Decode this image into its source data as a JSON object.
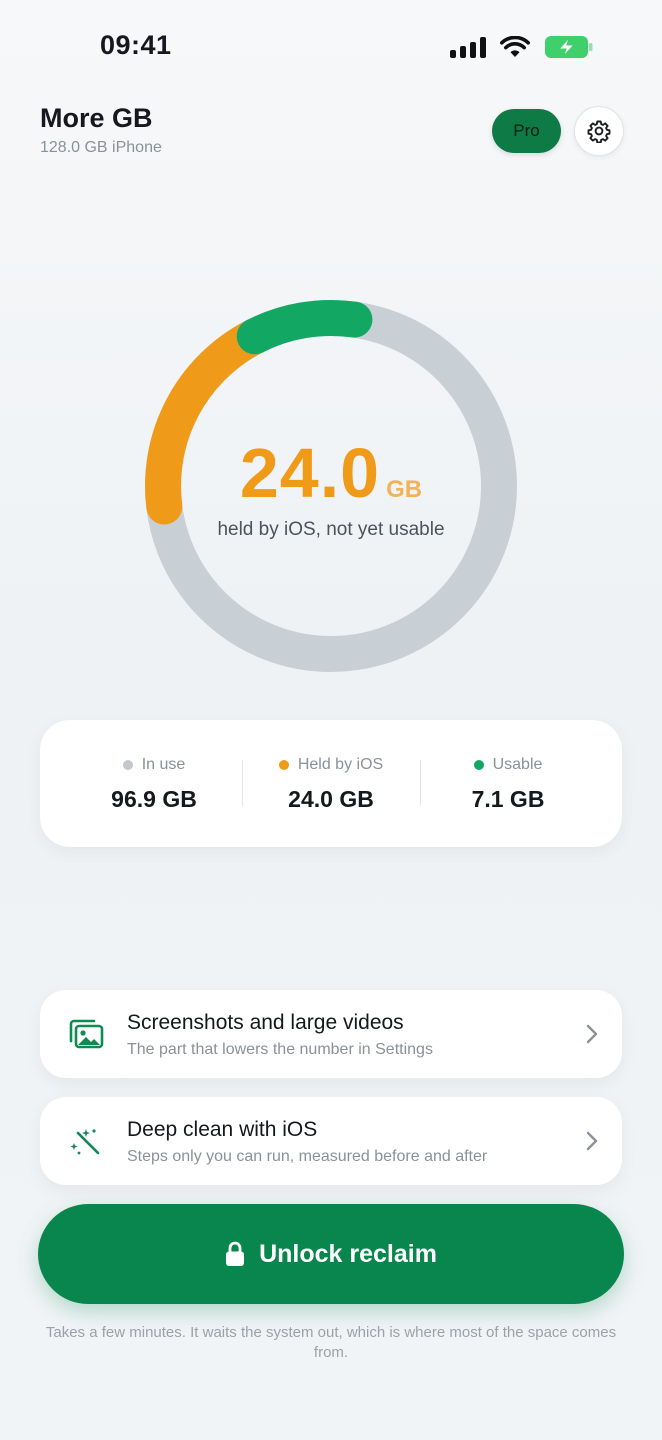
{
  "status_bar": {
    "time": "09:41"
  },
  "header": {
    "title": "More GB",
    "subtitle": "128.0 GB iPhone",
    "pro_label": "Pro"
  },
  "ring": {
    "value": "24.0",
    "unit": "GB",
    "caption": "held by iOS, not yet usable",
    "colors": {
      "track": "#c8d0d6",
      "held": "#f09a1a",
      "usable": "#12a864"
    }
  },
  "stats": [
    {
      "label": "In use",
      "value": "96.9 GB",
      "color": "#c3c8cd"
    },
    {
      "label": "Held by iOS",
      "value": "24.0 GB",
      "color": "#f09a1a"
    },
    {
      "label": "Usable",
      "value": "7.1 GB",
      "color": "#12a864"
    }
  ],
  "actions": [
    {
      "title": "Screenshots and large videos",
      "subtitle": "The part that lowers the number in Settings",
      "icon": "photos-icon"
    },
    {
      "title": "Deep clean with iOS",
      "subtitle": "Steps only you can run, measured before and after",
      "icon": "magic-wand-icon"
    }
  ],
  "primary_button": {
    "label": "Unlock reclaim",
    "icon": "lock-icon"
  },
  "footnote": "Takes a few minutes. It waits the system out, which is where most of the space comes from."
}
